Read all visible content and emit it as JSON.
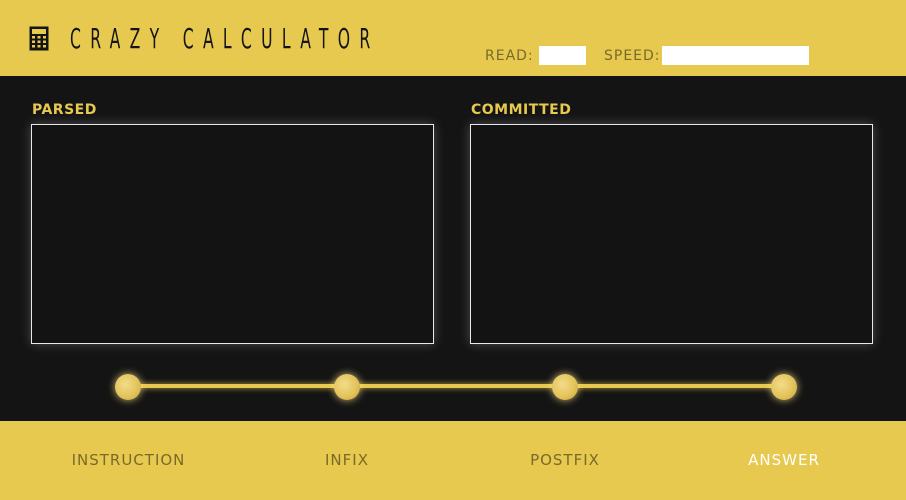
{
  "header": {
    "logo_icon": "calculator-icon",
    "title": "CRAZY CALCULATOR",
    "read_label": "READ:",
    "read_value": "",
    "speed_label": "SPEED:",
    "speed_value": "",
    "background": "#e6c94e"
  },
  "panels": {
    "parsed_label": "PARSED",
    "parsed_content": "",
    "committed_label": "COMMITTED",
    "committed_content": ""
  },
  "steps": {
    "count": 4,
    "accent": "#e6c94e"
  },
  "tabs": [
    {
      "label": "INSTRUCTION",
      "active": false
    },
    {
      "label": "INFIX",
      "active": false
    },
    {
      "label": "POSTFIX",
      "active": false
    },
    {
      "label": "ANSWER",
      "active": true
    }
  ],
  "colors": {
    "accent": "#e6c94e",
    "dark": "#141414",
    "tab_inactive": "#7a6a2a",
    "tab_active": "#ffffff"
  }
}
